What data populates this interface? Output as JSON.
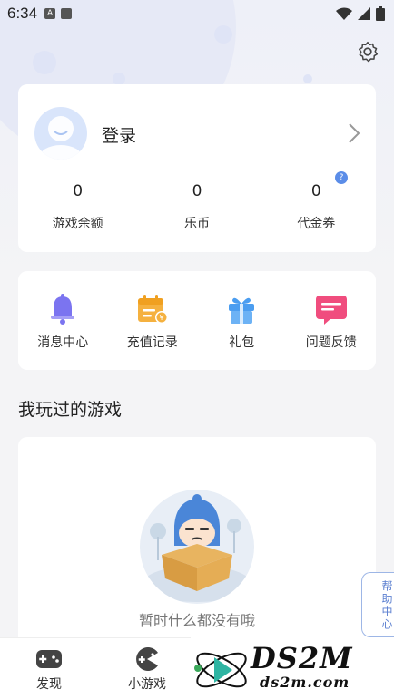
{
  "status_bar": {
    "time": "6:34"
  },
  "profile": {
    "login_label": "登录",
    "stats": [
      {
        "value": "0",
        "label": "游戏余额"
      },
      {
        "value": "0",
        "label": "乐币"
      },
      {
        "value": "0",
        "label": "代金券"
      }
    ],
    "badge": "?"
  },
  "menu": [
    {
      "label": "消息中心",
      "icon": "bell-icon"
    },
    {
      "label": "充值记录",
      "icon": "recharge-record-icon"
    },
    {
      "label": "礼包",
      "icon": "gift-icon"
    },
    {
      "label": "问题反馈",
      "icon": "feedback-icon"
    }
  ],
  "played_games": {
    "title": "我玩过的游戏",
    "empty_text": "暂时什么都没有哦"
  },
  "help_center": "帮助中心",
  "bottom_nav": [
    {
      "label": "发现",
      "icon": "gamepad-icon"
    },
    {
      "label": "小游戏",
      "icon": "pacman-icon"
    }
  ],
  "watermark": {
    "big": "DS2M",
    "small": "ds2m.com"
  },
  "colors": {
    "accent": "#5b8de8",
    "bell": "#7b74f0",
    "recharge": "#f5b13f",
    "gift": "#4b9df0",
    "feedback": "#f04d7e"
  }
}
